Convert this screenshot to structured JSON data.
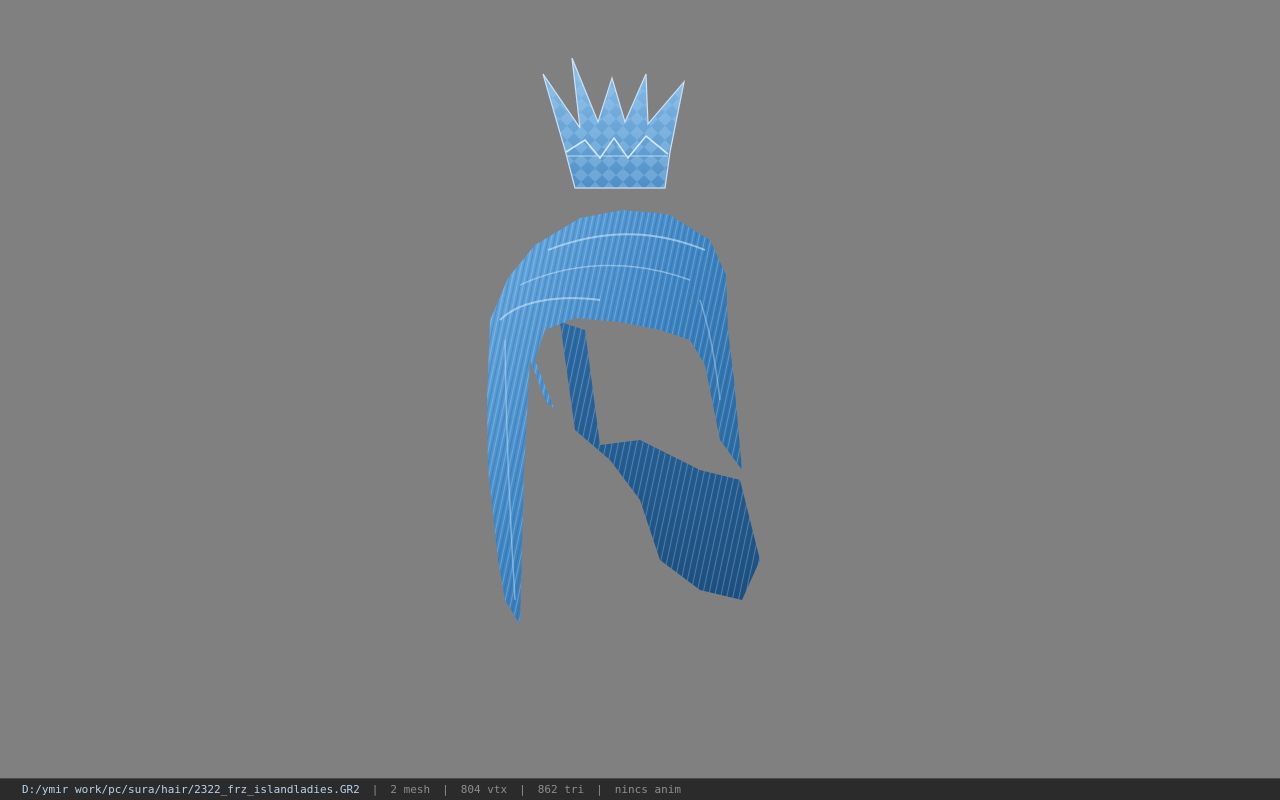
{
  "viewer": {
    "background_color": "#808080",
    "model_color": "#3f86c4"
  },
  "model": {
    "crown": {
      "icon": "crown-mesh"
    },
    "hair": {
      "icon": "hair-mesh"
    }
  },
  "status_bar": {
    "file_path": "D:/ymir work/pc/sura/hair/2322_frz_islandladies.GR2",
    "separator": "|",
    "mesh_count": "2 mesh",
    "vertex_count": "804 vtx",
    "triangle_count": "862 tri",
    "anim_status": "nincs anim"
  }
}
